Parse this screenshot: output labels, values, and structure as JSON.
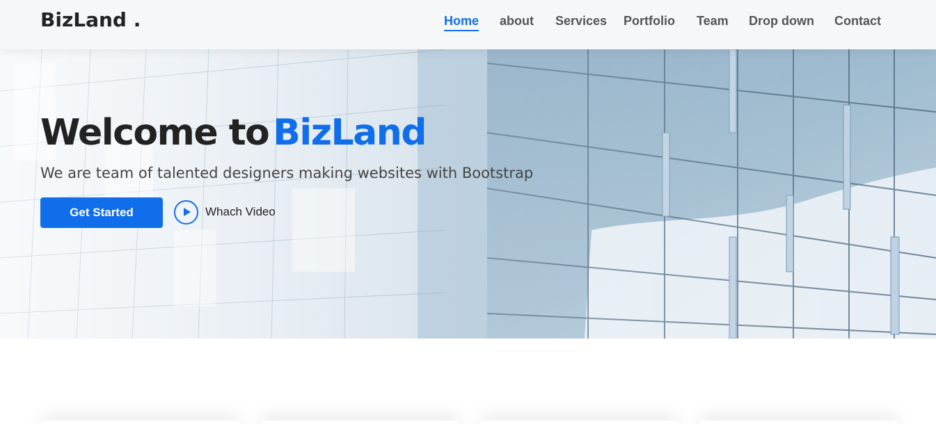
{
  "header": {
    "logo": "BizLand .",
    "nav": [
      {
        "label": "Home",
        "active": true
      },
      {
        "label": "about",
        "active": false
      },
      {
        "label": "Services",
        "active": false
      },
      {
        "label": "Portfolio",
        "active": false
      },
      {
        "label": "Team",
        "active": false
      },
      {
        "label": "Drop down",
        "active": false
      },
      {
        "label": "Contact",
        "active": false
      }
    ]
  },
  "hero": {
    "title_part1": "Welcome to",
    "title_part2": "BizLand",
    "subtitle": "We are team of talented designers making websites with Bootstrap",
    "cta_label": "Get Started",
    "video_label": "Whach Video"
  },
  "colors": {
    "accent": "#106eea",
    "text_dark": "#222222",
    "nav_text": "#555555",
    "header_bg": "#f6f7f9"
  },
  "icons": {
    "play": "play-circle-icon"
  }
}
